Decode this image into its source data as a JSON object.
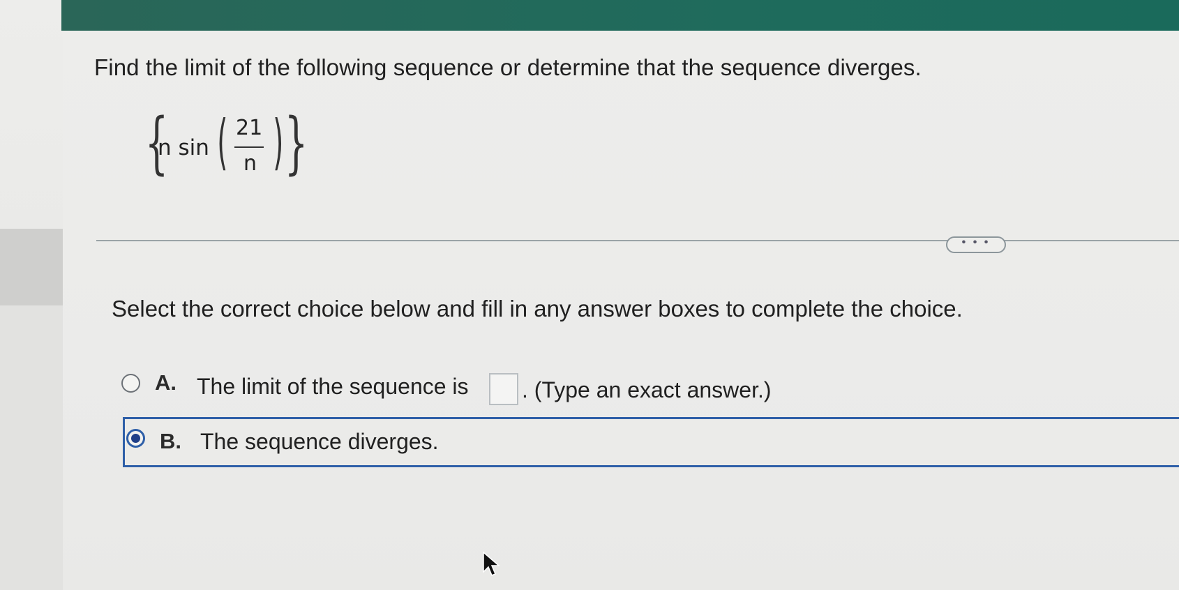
{
  "header": {
    "accent_color": "#1f6b5c"
  },
  "problem": {
    "question": "Find the limit of the following sequence or determine that the sequence diverges.",
    "expression": {
      "prefix": "n sin",
      "numerator": "21",
      "denominator": "n"
    }
  },
  "divider": {
    "more_label": "• • •"
  },
  "instruction": "Select the correct choice below and fill in any answer boxes to complete the choice.",
  "choices": [
    {
      "letter": "A.",
      "text_before": "The limit of the sequence is",
      "answer_value": "",
      "text_after": ". (Type an exact answer.)",
      "selected": false
    },
    {
      "letter": "B.",
      "text": "The sequence diverges.",
      "selected": true,
      "selection_color": "#2e5fa8"
    }
  ],
  "cursor": {
    "icon": "arrow-pointer-icon"
  }
}
